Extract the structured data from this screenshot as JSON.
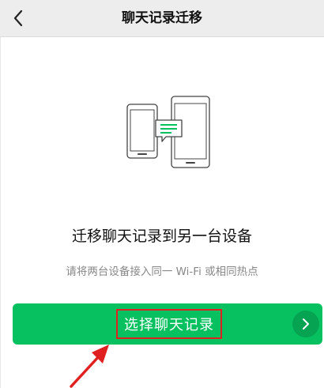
{
  "header": {
    "title": "聊天记录迁移",
    "back_icon": "chevron-left-icon"
  },
  "illustration": {
    "icon": "phone-to-tablet-transfer-icon",
    "accent_color": "#07c160"
  },
  "main": {
    "title": "迁移聊天记录到另一台设备",
    "subtitle": "请将两台设备接入同一 Wi-Fi 或相同热点"
  },
  "cta": {
    "label": "选择聊天记录",
    "arrow_icon": "chevron-right-icon",
    "color": "#07c160",
    "highlight_color": "#e02020"
  },
  "annotation": {
    "arrow_icon": "red-pointer-arrow-icon",
    "color": "#e02020"
  }
}
